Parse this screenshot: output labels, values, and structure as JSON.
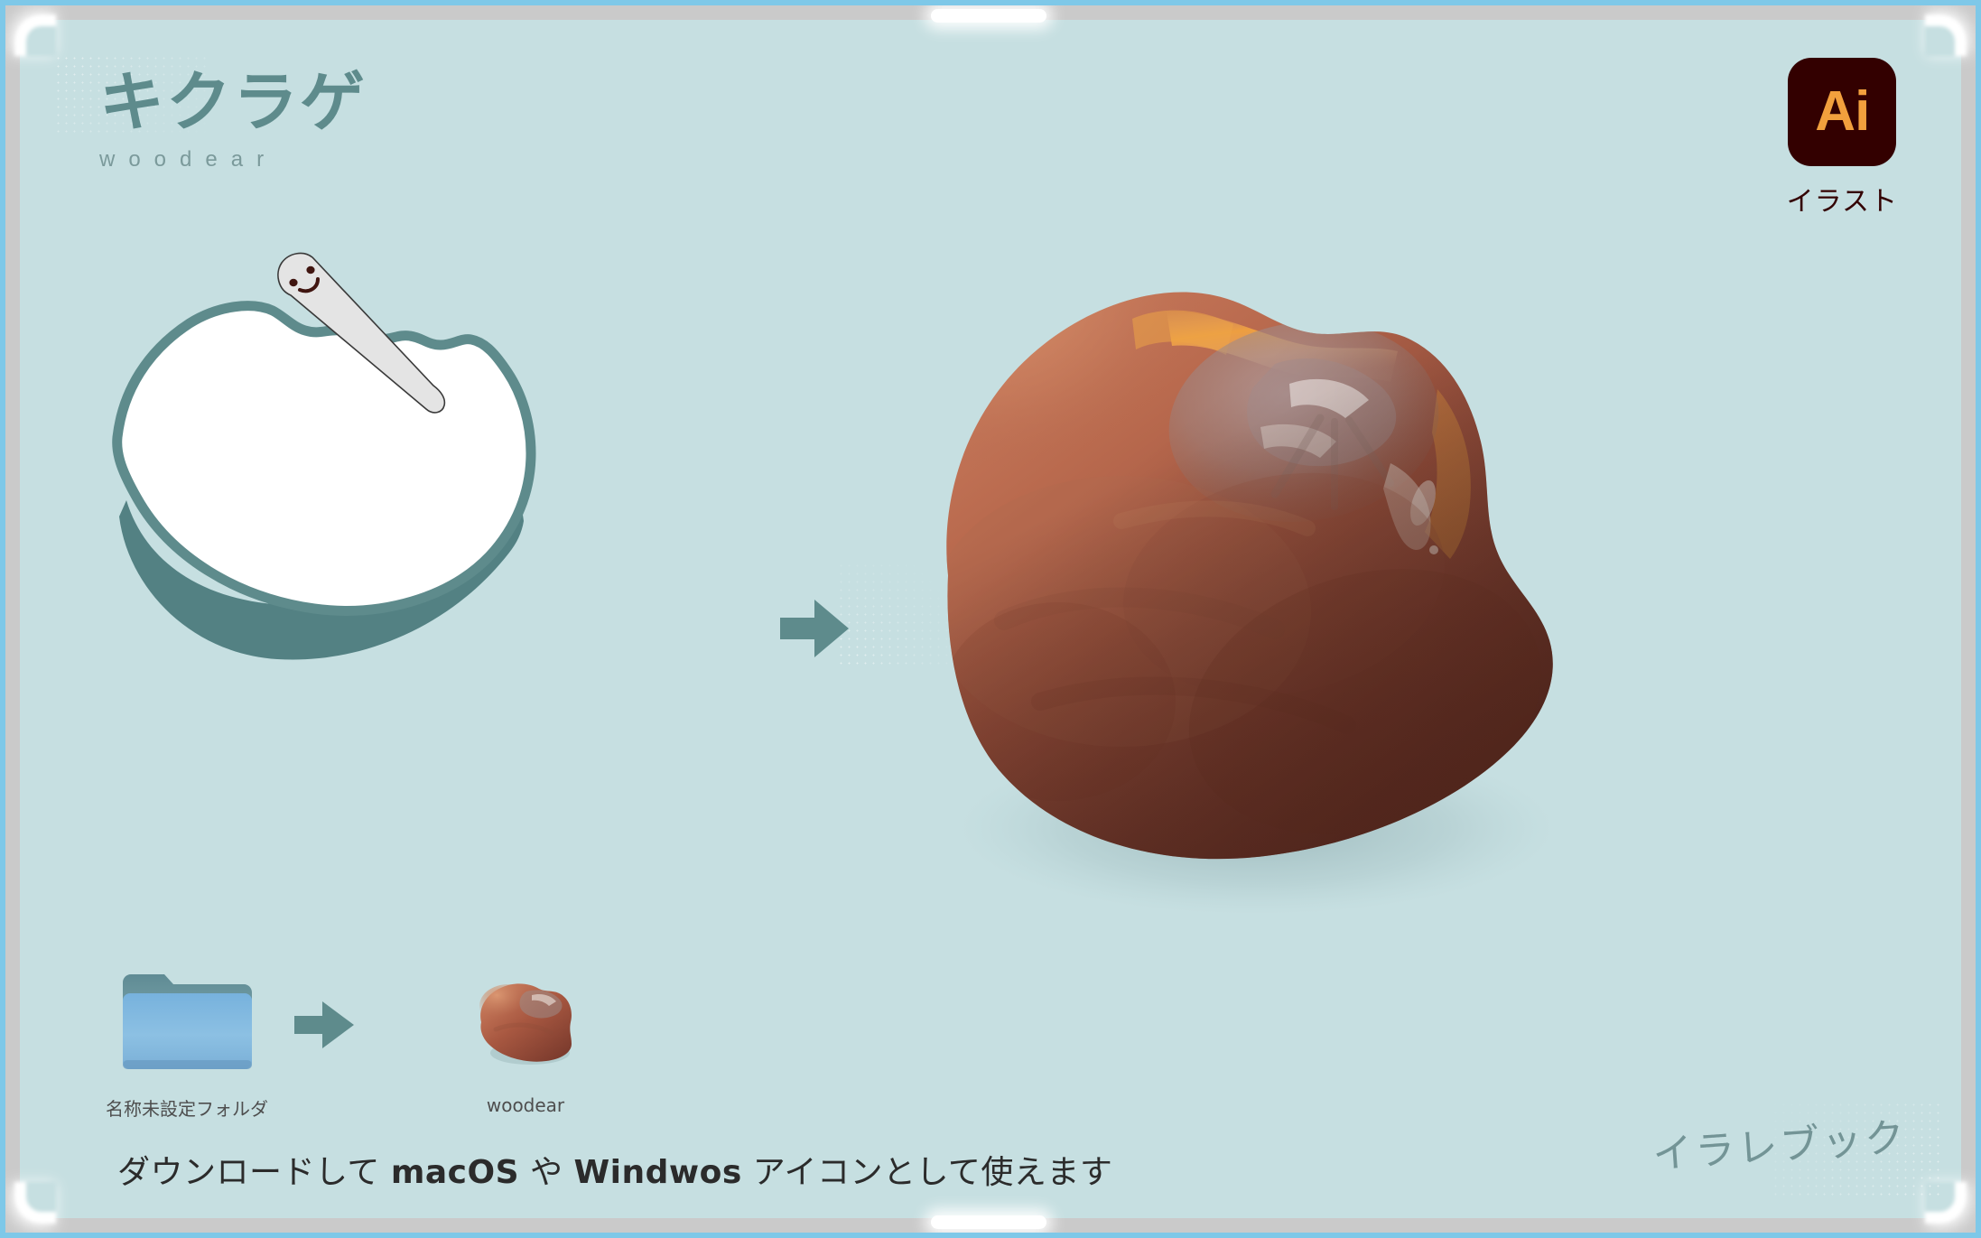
{
  "header": {
    "title": "キクラゲ",
    "subtitle": "woodear"
  },
  "badge": {
    "logo_text": "Ai",
    "caption": "イラスト",
    "bg_color": "#330000",
    "fg_color": "#f2a03d"
  },
  "icons": {
    "folder": {
      "icon": "folder-icon",
      "caption": "名称未設定フォルダ"
    },
    "arrow": {
      "icon": "arrow-right-icon"
    },
    "result": {
      "icon": "woodear-icon",
      "caption": "woodear"
    }
  },
  "center_arrow": {
    "icon": "arrow-right-icon"
  },
  "footer": {
    "caption_part1": "ダウンロードして ",
    "caption_macos": "macOS",
    "caption_part2": " や ",
    "caption_windows": "Windwos",
    "caption_part3": " アイコンとして使えます",
    "watermark": "イラレブック"
  },
  "illustration": {
    "silhouette_name": "woodear-silhouette",
    "stylus_name": "stylus-character",
    "mushroom_name": "woodear-mushroom-illustration"
  },
  "colors": {
    "canvas_bg": "#c6dfe1",
    "teal": "#5e8b8c",
    "teal_dark": "#538183",
    "frame": "#cacaca",
    "frame_accent": "#7ec8e8",
    "mushroom_light": "#d08a66",
    "mushroom_mid": "#a85c43",
    "mushroom_dark": "#7e4133",
    "mushroom_highlight": "#e8a86a"
  }
}
